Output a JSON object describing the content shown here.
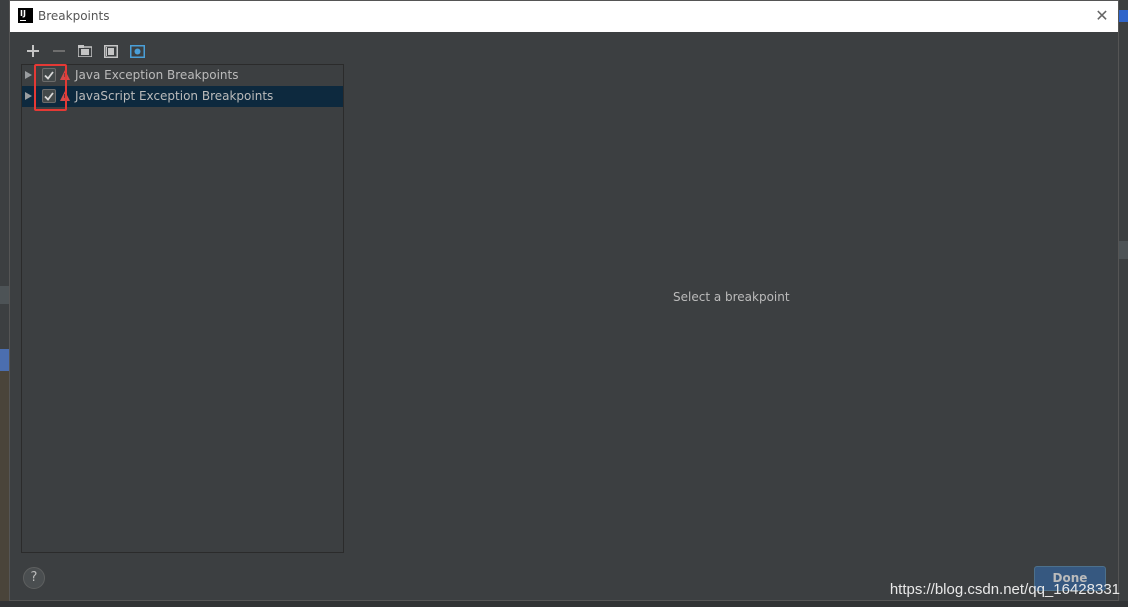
{
  "window": {
    "app_logo": "IJ",
    "title": "Breakpoints",
    "close_glyph": "✕"
  },
  "toolbar": {
    "buttons": [
      {
        "name": "add",
        "icon": "plus-icon"
      },
      {
        "name": "remove",
        "icon": "minus-icon"
      },
      {
        "name": "group-by-package",
        "icon": "folder-icon"
      },
      {
        "name": "group-by-class",
        "icon": "class-icon"
      },
      {
        "name": "group-by-file",
        "icon": "file-icon"
      }
    ]
  },
  "tree": {
    "items": [
      {
        "label": "Java Exception Breakpoints",
        "checked": true,
        "selected": false
      },
      {
        "label": "JavaScript Exception Breakpoints",
        "checked": true,
        "selected": true
      }
    ]
  },
  "detail": {
    "placeholder": "Select a breakpoint"
  },
  "footer": {
    "help_label": "?",
    "done_label": "Done"
  },
  "watermark": "https://blog.csdn.net/qq_16428331",
  "colors": {
    "dialog_bg": "#3c3f41",
    "selection_bg": "#0d293e",
    "highlight_border": "#e53935",
    "breakpoint_red": "#d14a4a",
    "done_bg": "#365880"
  }
}
